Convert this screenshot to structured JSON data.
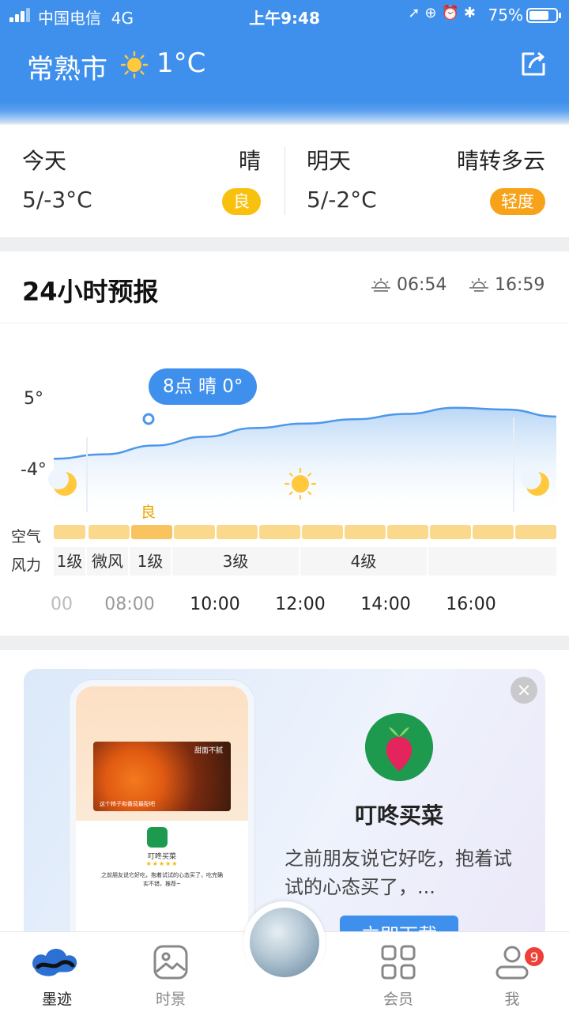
{
  "status_bar": {
    "carrier": "中国电信",
    "network": "4G",
    "time": "上午9:48",
    "battery": "75%",
    "battery_level": 0.75
  },
  "header": {
    "city": "常熟市",
    "weather_icon": "sun-icon",
    "current_temp": "1°C",
    "share_icon": "share-icon"
  },
  "days": [
    {
      "label": "今天",
      "condition": "晴",
      "range": "5/-3°C",
      "aqi": "良",
      "aqi_color": "#f8c10d"
    },
    {
      "label": "明天",
      "condition": "晴转多云",
      "range": "5/-2°C",
      "aqi": "轻度",
      "aqi_color": "#f7a31a"
    }
  ],
  "forecast": {
    "title": "24小时预报",
    "sunrise": "06:54",
    "sunset": "16:59",
    "max_label": "5°",
    "min_label": "-4°",
    "tooltip": "8点 晴 0°",
    "aqi_marker": "良",
    "row_air": "空气",
    "row_wind": "风力",
    "wind": [
      {
        "label": "1级"
      },
      {
        "label": "微风"
      },
      {
        "label": "1级"
      },
      {
        "label": "3级"
      },
      {
        "label": "4级"
      },
      {
        "label": ""
      }
    ],
    "hours": [
      {
        "label": "00"
      },
      {
        "label": "08:00"
      },
      {
        "label": "10:00"
      },
      {
        "label": "12:00"
      },
      {
        "label": "14:00"
      },
      {
        "label": "16:00"
      }
    ],
    "chart_data": {
      "type": "area",
      "ylim": [
        -4,
        5
      ],
      "ylabel": "",
      "xlabel": "",
      "series": [
        {
          "values": [
            -1.5,
            -1,
            0,
            1,
            2,
            2.5,
            3,
            3.6,
            4.3,
            4.1,
            3.3
          ]
        }
      ]
    }
  },
  "ad": {
    "app_name": "叮咚买菜",
    "description": "之前朋友说它好吃，抱着试试的心态买了，...",
    "cta": "立即下载",
    "phone_pic_caption": "甜面不腻",
    "phone_pic_note": "这个柿子和番茄最配吧",
    "phone_app_name": "叮咚买菜",
    "phone_stars": "★★★★★",
    "phone_text": "之前朋友说它好吃，抱着试试的心态买了，吃完确实不错，推荐~"
  },
  "nav": [
    {
      "label": "墨迹",
      "icon": "moji-icon",
      "active": true
    },
    {
      "label": "时景",
      "icon": "photo-icon",
      "active": false
    },
    {
      "label": "会员",
      "icon": "grid-icon",
      "active": false
    },
    {
      "label": "我",
      "icon": "user-icon",
      "active": false
    }
  ],
  "nav_badge": "9"
}
